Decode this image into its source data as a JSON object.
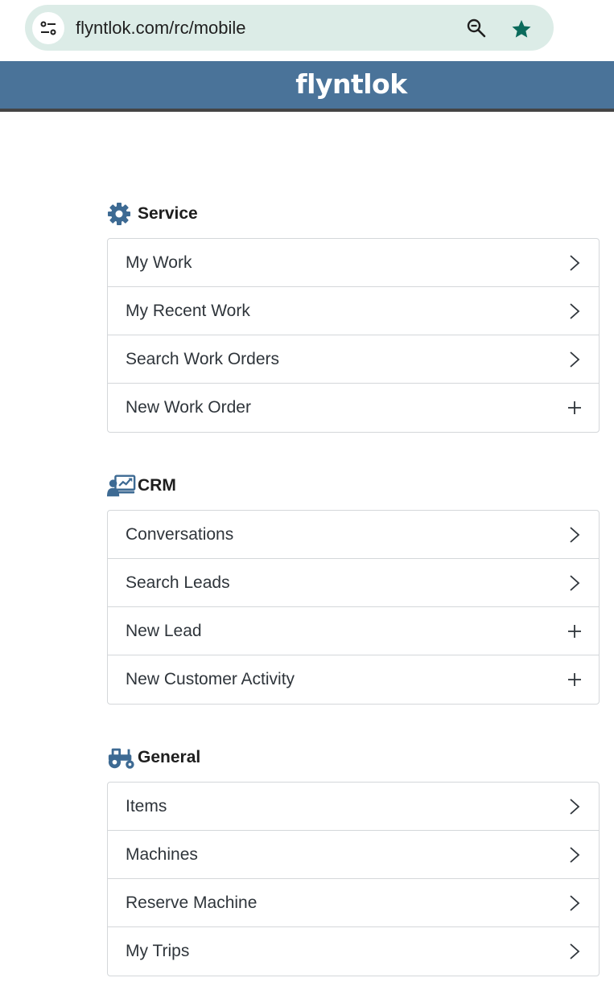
{
  "browser": {
    "url": "flyntlok.com/rc/mobile",
    "site_info_icon": "tune-icon",
    "zoom_icon": "zoom-out-icon",
    "bookmark_icon": "star-icon",
    "bookmark_color": "#0b6b5c"
  },
  "header": {
    "logo_text": "flyntlok",
    "background": "#4a7399"
  },
  "sections": [
    {
      "title": "Service",
      "icon": "gear-icon",
      "items": [
        {
          "label": "My Work",
          "action": "chevron-right-icon"
        },
        {
          "label": "My Recent Work",
          "action": "chevron-right-icon"
        },
        {
          "label": "Search Work Orders",
          "action": "chevron-right-icon"
        },
        {
          "label": "New Work Order",
          "action": "plus-icon"
        }
      ]
    },
    {
      "title": "CRM",
      "icon": "presenter-chart-icon",
      "items": [
        {
          "label": "Conversations",
          "action": "chevron-right-icon"
        },
        {
          "label": "Search Leads",
          "action": "chevron-right-icon"
        },
        {
          "label": "New Lead",
          "action": "plus-icon"
        },
        {
          "label": "New Customer Activity",
          "action": "plus-icon"
        }
      ]
    },
    {
      "title": "General",
      "icon": "tractor-icon",
      "items": [
        {
          "label": "Items",
          "action": "chevron-right-icon"
        },
        {
          "label": "Machines",
          "action": "chevron-right-icon"
        },
        {
          "label": "Reserve Machine",
          "action": "chevron-right-icon"
        },
        {
          "label": "My Trips",
          "action": "chevron-right-icon"
        }
      ]
    }
  ]
}
